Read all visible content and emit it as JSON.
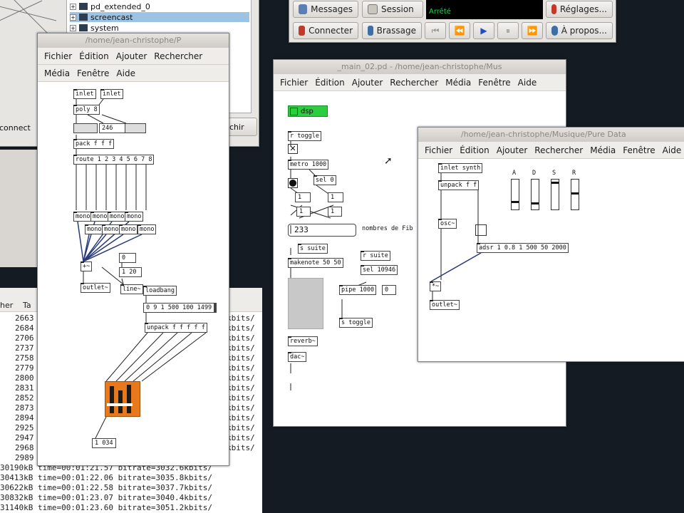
{
  "background": "#141b22",
  "tree_window": {
    "items": [
      {
        "label": "pd_extended_0",
        "selected": false
      },
      {
        "label": "screencast",
        "selected": true
      },
      {
        "label": "system",
        "selected": false
      }
    ],
    "left_partial": "connect",
    "right_partial": "chir"
  },
  "jack": {
    "buttons": {
      "messages": "Messages",
      "session": "Session",
      "settings": "Réglages...",
      "connect": "Connecter",
      "patchbay": "Brassage",
      "about": "À propos..."
    },
    "status": "Arrêté",
    "status_color": "#27d14a"
  },
  "terminal": {
    "header_left": "her",
    "header_right": "Ta",
    "partial_lines": [
      "2663",
      "2684",
      "2706",
      "2737",
      "2758",
      "2779",
      "2800",
      "2831",
      "2852",
      "2873",
      "2894",
      "2925",
      "2947",
      "2968",
      "2989"
    ],
    "right_fragments": [
      "kbits/",
      "kbits/",
      "kbits/",
      "kbits/",
      "kbits/",
      "kbits/",
      "kbits/",
      "kbits/",
      "kbits/",
      "kbits/",
      "kbits/",
      "kbits/",
      "kbits/",
      "kbits/"
    ],
    "full_lines": [
      "30190kB time=00:01:21.57 bitrate=3032.6kbits/",
      "30413kB time=00:01:22.06 bitrate=3035.8kbits/",
      "30622kB time=00:01:22.58 bitrate=3037.7kbits/",
      "30832kB time=00:01:23.07 bitrate=3040.4kbits/",
      "31140kB time=00:01:23.60 bitrate=3051.2kbits/"
    ]
  },
  "patch1": {
    "title": "/home/jean-christophe/P",
    "menu": {
      "row1": [
        "Fichier",
        "Édition",
        "Ajouter",
        "Rechercher"
      ],
      "row2": [
        "Média",
        "Fenêtre",
        "Aide"
      ]
    },
    "objects": {
      "inlet1": "inlet",
      "inlet2": "inlet",
      "poly": "poly 8",
      "num_poly": "246",
      "pack": "pack f f f",
      "route": "route 1 2 3 4 5 6 7 8",
      "mono": "mono",
      "add": "+~",
      "outlet": "outlet~",
      "num_a": "0",
      "num_b": "1 20",
      "line": "line~",
      "loadbang": "loadbang",
      "msg_env": "0 9 1 500 100 1499",
      "unpack": "unpack f f f f f",
      "num_bottom": "1 034"
    },
    "orange_fill": "#e8781c"
  },
  "patch2": {
    "title": "_main_02.pd - /home/jean-christophe/Mus",
    "menu": [
      "Fichier",
      "Édition",
      "Ajouter",
      "Rechercher",
      "Média",
      "Fenêtre",
      "Aide"
    ],
    "objects": {
      "dsp": "dsp",
      "r_toggle": "r toggle",
      "metro": "metro 1000",
      "sel0": "sel 0",
      "n1": "1",
      "n2": "1",
      "n3": "1",
      "n4": "1",
      "number": "233",
      "comment": "nombres de Fib",
      "s_suite": "s suite",
      "r_suite": "r suite",
      "sel2": "sel 10946",
      "makenote": "makenote 50 50",
      "pipe": "pipe 1000",
      "pipe_num": "0",
      "s_toggle": "s toggle",
      "reverb": "reverb~",
      "dac": "dac~"
    },
    "dsp_color": "#2ecc40"
  },
  "patch3": {
    "title": "/home/jean-christophe/Musique/Pure Data",
    "menu": [
      "Fichier",
      "Édition",
      "Ajouter",
      "Rechercher",
      "Média",
      "Fenêtre",
      "Aide"
    ],
    "objects": {
      "inlet": "inlet synth",
      "unpack": "unpack f f",
      "osc": "osc~",
      "adsr": "adsr 1 0.8 1 500 50 2000",
      "mult": "*~",
      "outlet": "outlet~"
    },
    "sliders": [
      {
        "label": "A",
        "level": 0.25
      },
      {
        "label": "D",
        "level": 0.2
      },
      {
        "label": "S",
        "level": 0.92
      },
      {
        "label": "R",
        "level": 0.55
      }
    ]
  }
}
